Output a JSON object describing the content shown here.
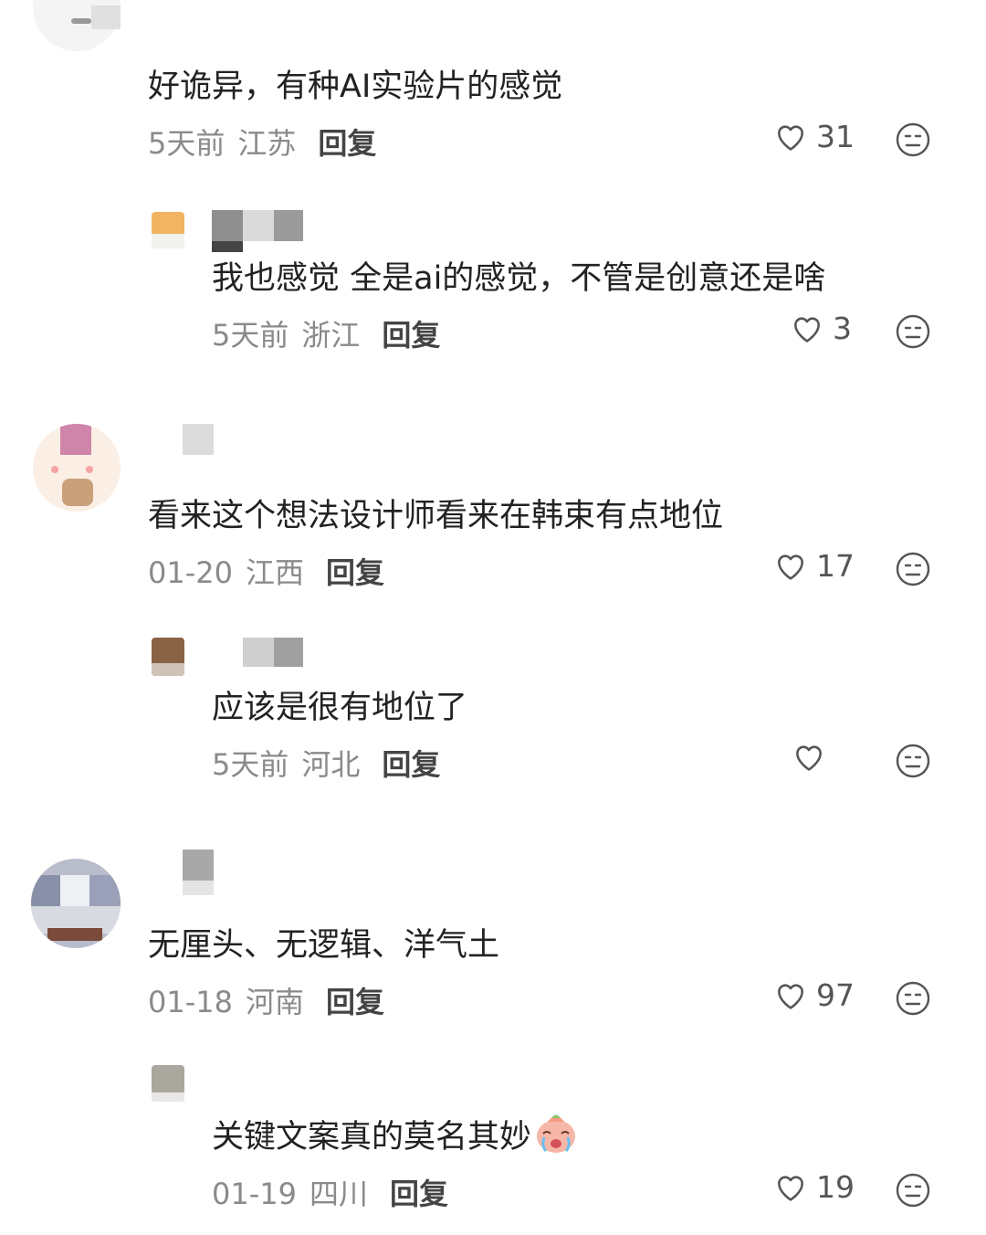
{
  "ui": {
    "reply_label": "回复"
  },
  "icons": {
    "like": "heart-outline-icon",
    "dislike": "neutral-face-icon",
    "emoji": "crying-face-emoji"
  },
  "colors": {
    "text": "#222222",
    "meta": "#8a8a8a",
    "icon": "#555555"
  },
  "comments": [
    {
      "text": "好诡异，有种AI实验片的感觉",
      "time": "5天前",
      "location": "江苏",
      "likes": "31",
      "replies": [
        {
          "text": "我也感觉 全是ai的感觉，不管是创意还是啥",
          "time": "5天前",
          "location": "浙江",
          "likes": "3"
        }
      ]
    },
    {
      "text": "看来这个想法设计师看来在韩束有点地位",
      "time": "01-20",
      "location": "江西",
      "likes": "17",
      "replies": [
        {
          "text": "应该是很有地位了",
          "time": "5天前",
          "location": "河北",
          "likes": ""
        }
      ]
    },
    {
      "text": "无厘头、无逻辑、洋气土",
      "time": "01-18",
      "location": "河南",
      "likes": "97",
      "replies": [
        {
          "text": "关键文案真的莫名其妙",
          "time": "01-19",
          "location": "四川",
          "likes": "19"
        }
      ]
    }
  ]
}
